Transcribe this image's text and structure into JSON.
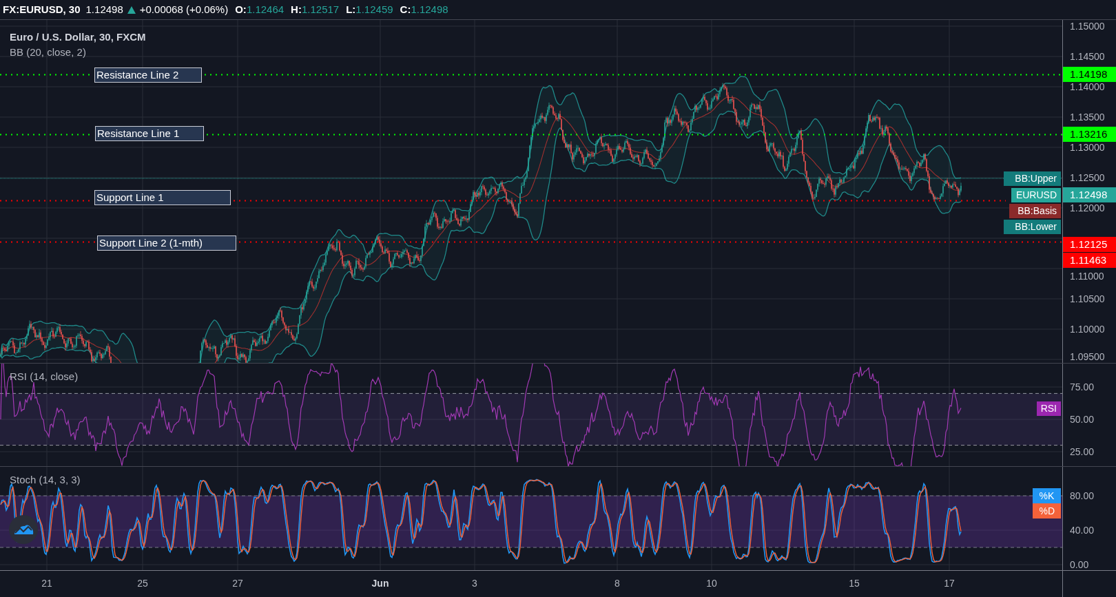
{
  "header": {
    "symbol": "FX:EURUSD, 30",
    "price": "1.12498",
    "change": "+0.00068 (+0.06%)",
    "ohlc": [
      {
        "label": "O:",
        "value": "1.12464"
      },
      {
        "label": "H:",
        "value": "1.12517"
      },
      {
        "label": "L:",
        "value": "1.12459"
      },
      {
        "label": "C:",
        "value": "1.12498"
      }
    ]
  },
  "main_pane": {
    "title": "Euro / U.S. Dollar, 30, FXCM",
    "indicator": "BB (20, close, 2)",
    "price_axis": [
      "1.15000",
      "1.14500",
      "1.14000",
      "1.13500",
      "1.13000",
      "1.12500",
      "1.12000",
      "1.11000",
      "1.10500",
      "1.10000",
      "1.09500"
    ],
    "level_lines": [
      {
        "label": "Resistance Line 2",
        "price": "1.14198",
        "kind": "resistance"
      },
      {
        "label": "Resistance Line 1",
        "price": "1.13216",
        "kind": "resistance"
      },
      {
        "label": "Support Line 1",
        "price": "1.12125",
        "kind": "support"
      },
      {
        "label": "Support Line 2 (1-mth)",
        "price": "1.11463",
        "kind": "support"
      }
    ],
    "current_price": {
      "label": "1.12498",
      "color": "#26a69a"
    },
    "series_tags": [
      {
        "label": "BB:Upper",
        "color": "#137b7b"
      },
      {
        "label": "EURUSD",
        "color": "#26a69a"
      },
      {
        "label": "BB:Basis",
        "color": "#8b2a2a"
      },
      {
        "label": "BB:Lower",
        "color": "#137b7b"
      }
    ]
  },
  "rsi_pane": {
    "title": "RSI (14, close)",
    "axis": [
      "75.00",
      "50.00",
      "25.00"
    ],
    "tag": {
      "label": "RSI",
      "color": "#9c27b0"
    }
  },
  "stoch_pane": {
    "title": "Stoch (14, 3, 3)",
    "axis": [
      "80.00",
      "40.00",
      "0.00"
    ],
    "tags": [
      {
        "label": "%K",
        "color": "#2196f3"
      },
      {
        "label": "%D",
        "color": "#f4623a"
      }
    ]
  },
  "time_axis": [
    {
      "label": "21",
      "kind": "day"
    },
    {
      "label": "25",
      "kind": "day"
    },
    {
      "label": "27",
      "kind": "day"
    },
    {
      "label": "Jun",
      "kind": "month"
    },
    {
      "label": "3",
      "kind": "day"
    },
    {
      "label": "8",
      "kind": "day"
    },
    {
      "label": "10",
      "kind": "day"
    },
    {
      "label": "15",
      "kind": "day"
    },
    {
      "label": "17",
      "kind": "day"
    }
  ]
}
